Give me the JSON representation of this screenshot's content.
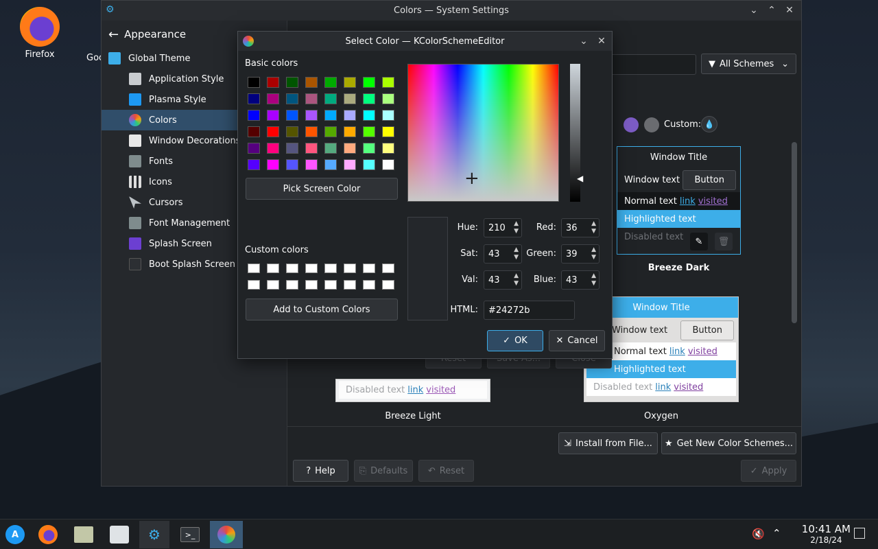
{
  "desktop": {
    "icons": [
      {
        "label": "Firefox"
      },
      {
        "label": "Goo"
      }
    ]
  },
  "settings_window": {
    "title": "Colors — System Settings",
    "section": "Appearance",
    "sidebar": [
      {
        "label": "Global Theme"
      },
      {
        "label": "Application Style"
      },
      {
        "label": "Plasma Style"
      },
      {
        "label": "Colors"
      },
      {
        "label": "Window Decorations"
      },
      {
        "label": "Fonts"
      },
      {
        "label": "Icons"
      },
      {
        "label": "Cursors"
      },
      {
        "label": "Font Management"
      },
      {
        "label": "Splash Screen"
      },
      {
        "label": "Boot Splash Screen"
      }
    ],
    "filter_combo": "All Schemes",
    "accent_custom_label": "Custom:",
    "schemes": [
      {
        "name": "Breeze Dark",
        "window_title": "Window Title",
        "text": "Window text",
        "button": "Button",
        "normal": "Normal text",
        "highlighted": "Highlighted text",
        "disabled": "Disabled text",
        "link": "link",
        "visited": "visited"
      },
      {
        "name": "Breeze Light",
        "disabled": "Disabled text",
        "link": "link",
        "visited": "visited"
      },
      {
        "name": "Oxygen",
        "window_title": "Window Title",
        "text": "Window text",
        "button": "Button",
        "normal": "Normal text",
        "highlighted": "Highlighted text",
        "disabled": "Disabled text",
        "link": "link",
        "visited": "visited"
      }
    ],
    "behind_dialog_buttons": {
      "reset": "Reset",
      "save_as": "Save As...",
      "close": "Close"
    },
    "install_from_file": "Install from File...",
    "get_new": "Get New Color Schemes...",
    "help": "Help",
    "defaults": "Defaults",
    "reset": "Reset",
    "apply": "Apply"
  },
  "dialog": {
    "title": "Select Color — KColorSchemeEditor",
    "basic_colors_label": "Basic colors",
    "basic_colors": [
      "#000000",
      "#aa0000",
      "#005500",
      "#aa5500",
      "#00aa00",
      "#aaaa00",
      "#00ff00",
      "#aaff00",
      "#00007f",
      "#aa007f",
      "#00557f",
      "#aa557f",
      "#00aa7f",
      "#aaaa7f",
      "#00ff7f",
      "#aaff7f",
      "#0000ff",
      "#aa00ff",
      "#0055ff",
      "#aa55ff",
      "#00aaff",
      "#aaaaff",
      "#00ffff",
      "#aaffff",
      "#550000",
      "#ff0000",
      "#555500",
      "#ff5500",
      "#55aa00",
      "#ffaa00",
      "#55ff00",
      "#ffff00",
      "#55007f",
      "#ff007f",
      "#55557f",
      "#ff557f",
      "#55aa7f",
      "#ffaa7f",
      "#55ff7f",
      "#ffff7f",
      "#5500ff",
      "#ff00ff",
      "#5555ff",
      "#ff55ff",
      "#55aaff",
      "#ffaaff",
      "#55ffff",
      "#ffffff"
    ],
    "pick_screen": "Pick Screen Color",
    "custom_colors_label": "Custom colors",
    "add_custom": "Add to Custom Colors",
    "fields": {
      "hue_label": "Hue:",
      "hue": "210",
      "sat_label": "Sat:",
      "sat": "43",
      "val_label": "Val:",
      "val": "43",
      "red_label": "Red:",
      "red": "36",
      "green_label": "Green:",
      "green": "39",
      "blue_label": "Blue:",
      "blue": "43",
      "html_label": "HTML:",
      "html": "#24272b"
    },
    "current_color": "#24272b",
    "ok": "OK",
    "cancel": "Cancel"
  },
  "taskbar": {
    "time": "10:41 AM",
    "date": "2/18/24"
  },
  "colors": {
    "accent": "#3daee9",
    "selection": "#304e6a"
  }
}
